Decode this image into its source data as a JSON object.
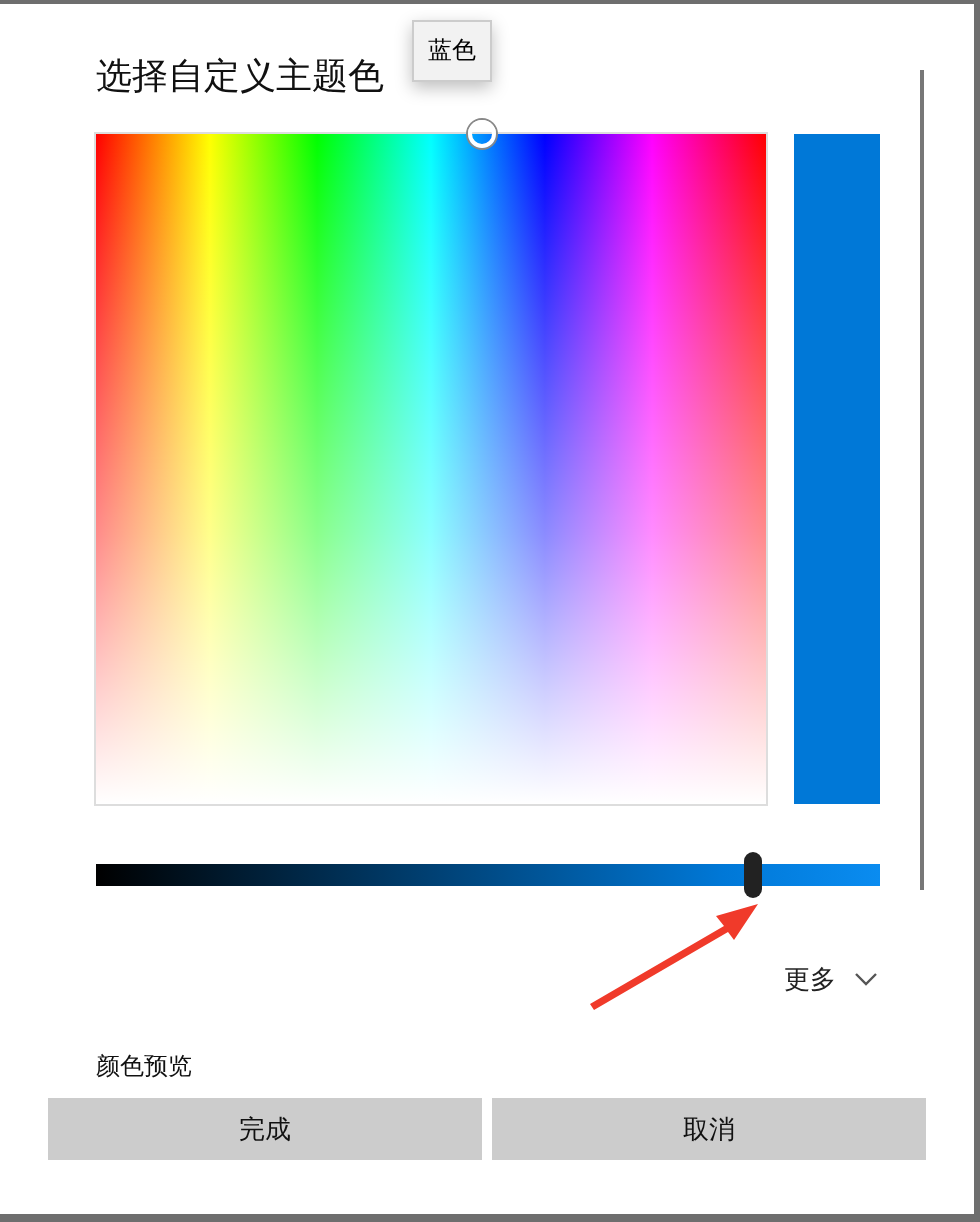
{
  "title": "选择自定义主题色",
  "tooltip": "蓝色",
  "brightness": {
    "level": 0.838
  },
  "more": {
    "label": "更多",
    "expanded": false
  },
  "preview_label": "颜色预览",
  "buttons": [
    "完成",
    "取消"
  ]
}
